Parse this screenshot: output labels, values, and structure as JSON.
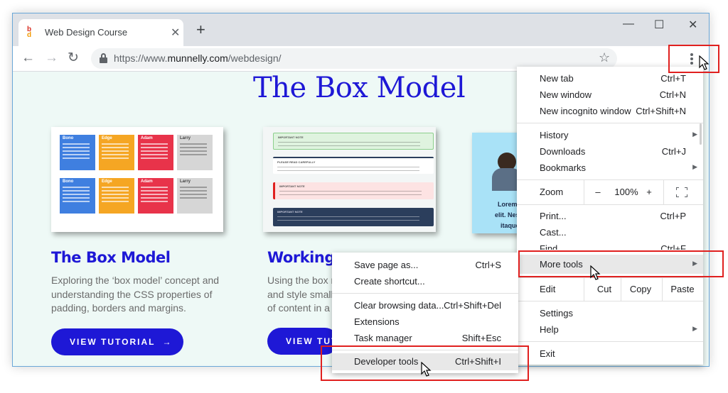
{
  "tab": {
    "title": "Web Design Course",
    "close_glyph": "✕"
  },
  "new_tab_glyph": "+",
  "window_controls": {
    "minimize": "—",
    "maximize": "☐",
    "close": "✕"
  },
  "toolbar": {
    "url_prefix": "https://www.",
    "url_host": "munnelly.com",
    "url_path": "/webdesign/",
    "icons": [
      "back-arrow-icon",
      "forward-arrow-icon",
      "reload-icon",
      "lock-icon",
      "star-icon",
      "kebab-menu-icon"
    ]
  },
  "page": {
    "heading": "The Box Model",
    "cards": [
      {
        "title": "The Box Model",
        "desc_lines": [
          "Exploring the ‘box model’ concept and",
          "understanding the CSS properties of",
          "padding, borders and margins."
        ],
        "button": "VIEW TUTORIAL",
        "grid_labels": [
          "Bono",
          "Edge",
          "Adam",
          "Larry",
          "Bono",
          "Edge",
          "Adam",
          "Larry"
        ]
      },
      {
        "title": "Working w",
        "desc_lines": [
          "Using the box m",
          "and style small,",
          "of content in a w"
        ],
        "button": "VIEW TUT",
        "notes": [
          "IMPORTANT NOTE",
          "PLEASE READ CAREFULLY",
          "IMPORTANT NOTE",
          "IMPORTANT NOTE"
        ]
      },
      {
        "partial_lines": [
          "Lorem ip",
          "elit. Nes",
          "itaque"
        ]
      }
    ]
  },
  "main_menu": {
    "new_tab": {
      "label": "New tab",
      "shortcut": "Ctrl+T"
    },
    "new_window": {
      "label": "New window",
      "shortcut": "Ctrl+N"
    },
    "new_incognito": {
      "label": "New incognito window",
      "shortcut": "Ctrl+Shift+N"
    },
    "history": {
      "label": "History"
    },
    "downloads": {
      "label": "Downloads",
      "shortcut": "Ctrl+J"
    },
    "bookmarks": {
      "label": "Bookmarks"
    },
    "zoom": {
      "label": "Zoom",
      "minus": "–",
      "value": "100%",
      "plus": "+"
    },
    "print": {
      "label": "Print...",
      "shortcut": "Ctrl+P"
    },
    "cast": {
      "label": "Cast..."
    },
    "find": {
      "label": "Find...",
      "shortcut": "Ctrl+F"
    },
    "more_tools": {
      "label": "More tools"
    },
    "edit": {
      "label": "Edit",
      "cut": "Cut",
      "copy": "Copy",
      "paste": "Paste"
    },
    "settings": {
      "label": "Settings"
    },
    "help": {
      "label": "Help"
    },
    "exit": {
      "label": "Exit"
    }
  },
  "sub_menu": {
    "save_page": {
      "label": "Save page as...",
      "shortcut": "Ctrl+S"
    },
    "create_shortcut": {
      "label": "Create shortcut..."
    },
    "clear_browsing": {
      "label": "Clear browsing data...",
      "shortcut": "Ctrl+Shift+Del"
    },
    "extensions": {
      "label": "Extensions"
    },
    "task_manager": {
      "label": "Task manager",
      "shortcut": "Shift+Esc"
    },
    "developer_tools": {
      "label": "Developer tools",
      "shortcut": "Ctrl+Shift+I"
    }
  },
  "colors": {
    "accent": "#1e18d6",
    "highlight_box": "#e0201f",
    "page_bg": "#eef9f6",
    "grid": [
      "#3f7fe0",
      "#f5a623",
      "#e8334a",
      "#d6d6d6"
    ]
  }
}
